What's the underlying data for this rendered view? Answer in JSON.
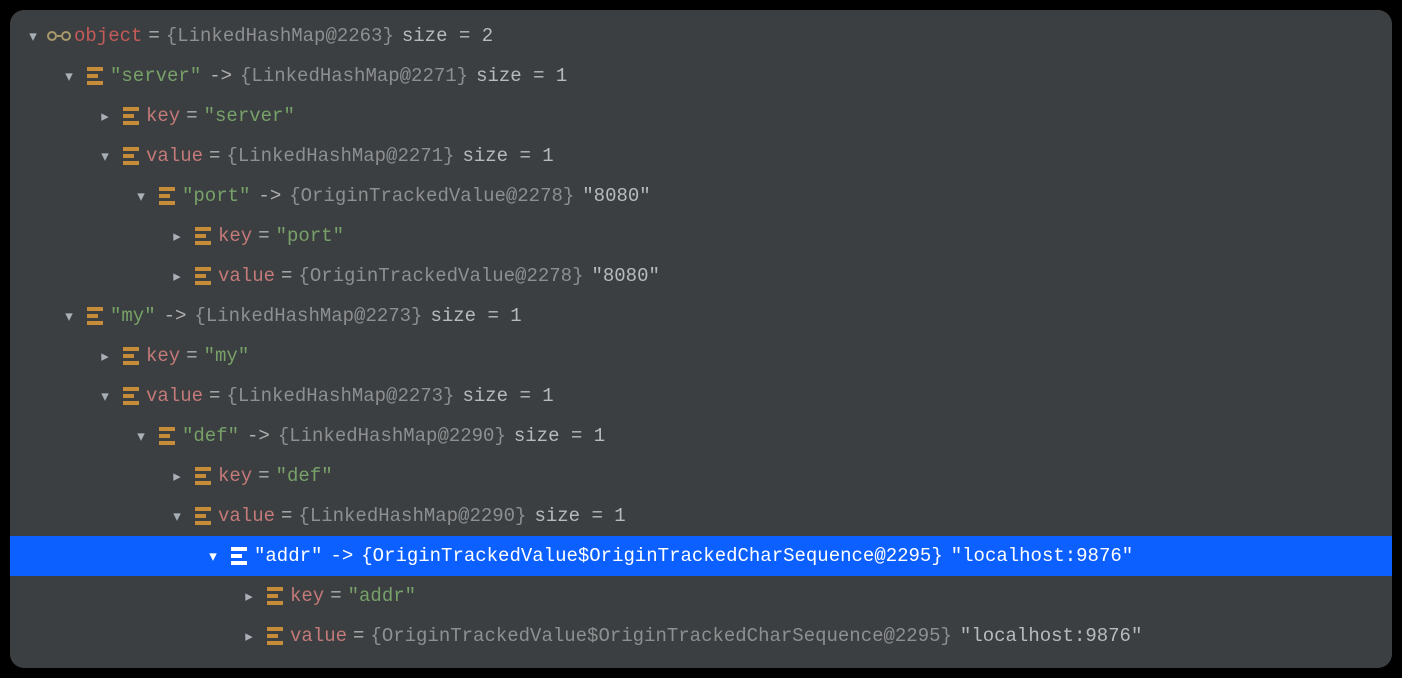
{
  "indentUnit": 36,
  "rows": [
    {
      "indent": 0,
      "expanded": true,
      "icon": "glasses",
      "parts": [
        {
          "cls": "varname",
          "key": "r0.name"
        },
        {
          "cls": "eq",
          "key": "r0.eq"
        },
        {
          "cls": "typeinfo",
          "key": "r0.type"
        },
        {
          "cls": "sizeinfo",
          "key": "r0.size"
        }
      ],
      "data": {
        "name": "object",
        "eq": "=",
        "type": "{LinkedHashMap@2263}",
        "size": " size = 2"
      }
    },
    {
      "indent": 1,
      "expanded": true,
      "icon": "map",
      "parts": [
        {
          "cls": "strval",
          "key": "r1.label"
        },
        {
          "cls": "arrow",
          "key": "r1.arrow"
        },
        {
          "cls": "typeinfo",
          "key": "r1.type"
        },
        {
          "cls": "sizeinfo",
          "key": "r1.size"
        }
      ],
      "data": {
        "label": "\"server\"",
        "arrow": "->",
        "type": "{LinkedHashMap@2271}",
        "size": " size = 1"
      }
    },
    {
      "indent": 2,
      "expanded": false,
      "icon": "map",
      "parts": [
        {
          "cls": "fieldname",
          "key": "r2.name"
        },
        {
          "cls": "eq",
          "key": "r2.eq"
        },
        {
          "cls": "strval",
          "key": "r2.val"
        }
      ],
      "data": {
        "name": "key",
        "eq": "=",
        "val": "\"server\""
      }
    },
    {
      "indent": 2,
      "expanded": true,
      "icon": "map",
      "parts": [
        {
          "cls": "fieldname",
          "key": "r3.name"
        },
        {
          "cls": "eq",
          "key": "r3.eq"
        },
        {
          "cls": "typeinfo",
          "key": "r3.type"
        },
        {
          "cls": "sizeinfo",
          "key": "r3.size"
        }
      ],
      "data": {
        "name": "value",
        "eq": "=",
        "type": "{LinkedHashMap@2271}",
        "size": " size = 1"
      }
    },
    {
      "indent": 3,
      "expanded": true,
      "icon": "map",
      "parts": [
        {
          "cls": "strval",
          "key": "r4.label"
        },
        {
          "cls": "arrow",
          "key": "r4.arrow"
        },
        {
          "cls": "typeinfo",
          "key": "r4.type"
        },
        {
          "cls": "sizeinfo",
          "key": "r4.val"
        }
      ],
      "data": {
        "label": "\"port\"",
        "arrow": "->",
        "type": "{OriginTrackedValue@2278}",
        "val": " \"8080\""
      }
    },
    {
      "indent": 4,
      "expanded": false,
      "icon": "map",
      "parts": [
        {
          "cls": "fieldname",
          "key": "r5.name"
        },
        {
          "cls": "eq",
          "key": "r5.eq"
        },
        {
          "cls": "strval",
          "key": "r5.val"
        }
      ],
      "data": {
        "name": "key",
        "eq": "=",
        "val": "\"port\""
      }
    },
    {
      "indent": 4,
      "expanded": false,
      "icon": "map",
      "parts": [
        {
          "cls": "fieldname",
          "key": "r6.name"
        },
        {
          "cls": "eq",
          "key": "r6.eq"
        },
        {
          "cls": "typeinfo",
          "key": "r6.type"
        },
        {
          "cls": "sizeinfo",
          "key": "r6.val"
        }
      ],
      "data": {
        "name": "value",
        "eq": "=",
        "type": "{OriginTrackedValue@2278}",
        "val": " \"8080\""
      }
    },
    {
      "indent": 1,
      "expanded": true,
      "icon": "map",
      "parts": [
        {
          "cls": "strval",
          "key": "r7.label"
        },
        {
          "cls": "arrow",
          "key": "r7.arrow"
        },
        {
          "cls": "typeinfo",
          "key": "r7.type"
        },
        {
          "cls": "sizeinfo",
          "key": "r7.size"
        }
      ],
      "data": {
        "label": "\"my\"",
        "arrow": "->",
        "type": "{LinkedHashMap@2273}",
        "size": " size = 1"
      }
    },
    {
      "indent": 2,
      "expanded": false,
      "icon": "map",
      "parts": [
        {
          "cls": "fieldname",
          "key": "r8.name"
        },
        {
          "cls": "eq",
          "key": "r8.eq"
        },
        {
          "cls": "strval",
          "key": "r8.val"
        }
      ],
      "data": {
        "name": "key",
        "eq": "=",
        "val": "\"my\""
      }
    },
    {
      "indent": 2,
      "expanded": true,
      "icon": "map",
      "parts": [
        {
          "cls": "fieldname",
          "key": "r9.name"
        },
        {
          "cls": "eq",
          "key": "r9.eq"
        },
        {
          "cls": "typeinfo",
          "key": "r9.type"
        },
        {
          "cls": "sizeinfo",
          "key": "r9.size"
        }
      ],
      "data": {
        "name": "value",
        "eq": "=",
        "type": "{LinkedHashMap@2273}",
        "size": " size = 1"
      }
    },
    {
      "indent": 3,
      "expanded": true,
      "icon": "map",
      "parts": [
        {
          "cls": "strval",
          "key": "r10.label"
        },
        {
          "cls": "arrow",
          "key": "r10.arrow"
        },
        {
          "cls": "typeinfo",
          "key": "r10.type"
        },
        {
          "cls": "sizeinfo",
          "key": "r10.size"
        }
      ],
      "data": {
        "label": "\"def\"",
        "arrow": "->",
        "type": "{LinkedHashMap@2290}",
        "size": " size = 1"
      }
    },
    {
      "indent": 4,
      "expanded": false,
      "icon": "map",
      "parts": [
        {
          "cls": "fieldname",
          "key": "r11.name"
        },
        {
          "cls": "eq",
          "key": "r11.eq"
        },
        {
          "cls": "strval",
          "key": "r11.val"
        }
      ],
      "data": {
        "name": "key",
        "eq": "=",
        "val": "\"def\""
      }
    },
    {
      "indent": 4,
      "expanded": true,
      "icon": "map",
      "parts": [
        {
          "cls": "fieldname",
          "key": "r12.name"
        },
        {
          "cls": "eq",
          "key": "r12.eq"
        },
        {
          "cls": "typeinfo",
          "key": "r12.type"
        },
        {
          "cls": "sizeinfo",
          "key": "r12.size"
        }
      ],
      "data": {
        "name": "value",
        "eq": "=",
        "type": "{LinkedHashMap@2290}",
        "size": " size = 1"
      }
    },
    {
      "indent": 5,
      "expanded": true,
      "icon": "map",
      "selected": true,
      "parts": [
        {
          "cls": "strval",
          "key": "r13.label"
        },
        {
          "cls": "arrow",
          "key": "r13.arrow"
        },
        {
          "cls": "typeinfo",
          "key": "r13.type"
        },
        {
          "cls": "sizeinfo",
          "key": "r13.val"
        }
      ],
      "data": {
        "label": "\"addr\"",
        "arrow": "->",
        "type": "{OriginTrackedValue$OriginTrackedCharSequence@2295}",
        "val": " \"localhost:9876\""
      }
    },
    {
      "indent": 6,
      "expanded": false,
      "icon": "map",
      "parts": [
        {
          "cls": "fieldname",
          "key": "r14.name"
        },
        {
          "cls": "eq",
          "key": "r14.eq"
        },
        {
          "cls": "strval",
          "key": "r14.val"
        }
      ],
      "data": {
        "name": "key",
        "eq": "=",
        "val": "\"addr\""
      }
    },
    {
      "indent": 6,
      "expanded": false,
      "icon": "map",
      "parts": [
        {
          "cls": "fieldname",
          "key": "r15.name"
        },
        {
          "cls": "eq",
          "key": "r15.eq"
        },
        {
          "cls": "typeinfo",
          "key": "r15.type"
        },
        {
          "cls": "sizeinfo",
          "key": "r15.val"
        }
      ],
      "data": {
        "name": "value",
        "eq": "=",
        "type": "{OriginTrackedValue$OriginTrackedCharSequence@2295}",
        "val": " \"localhost:9876\""
      }
    }
  ],
  "r0": {
    "name": "object",
    "eq": "=",
    "type": "{LinkedHashMap@2263}",
    "size": " size = 2"
  },
  "r1": {
    "label": "\"server\"",
    "arrow": "->",
    "type": "{LinkedHashMap@2271}",
    "size": " size = 1"
  },
  "r2": {
    "name": "key",
    "eq": "=",
    "val": "\"server\""
  },
  "r3": {
    "name": "value",
    "eq": "=",
    "type": "{LinkedHashMap@2271}",
    "size": " size = 1"
  },
  "r4": {
    "label": "\"port\"",
    "arrow": "->",
    "type": "{OriginTrackedValue@2278}",
    "val": " \"8080\""
  },
  "r5": {
    "name": "key",
    "eq": "=",
    "val": "\"port\""
  },
  "r6": {
    "name": "value",
    "eq": "=",
    "type": "{OriginTrackedValue@2278}",
    "val": " \"8080\""
  },
  "r7": {
    "label": "\"my\"",
    "arrow": "->",
    "type": "{LinkedHashMap@2273}",
    "size": " size = 1"
  },
  "r8": {
    "name": "key",
    "eq": "=",
    "val": "\"my\""
  },
  "r9": {
    "name": "value",
    "eq": "=",
    "type": "{LinkedHashMap@2273}",
    "size": " size = 1"
  },
  "r10": {
    "label": "\"def\"",
    "arrow": "->",
    "type": "{LinkedHashMap@2290}",
    "size": " size = 1"
  },
  "r11": {
    "name": "key",
    "eq": "=",
    "val": "\"def\""
  },
  "r12": {
    "name": "value",
    "eq": "=",
    "type": "{LinkedHashMap@2290}",
    "size": " size = 1"
  },
  "r13": {
    "label": "\"addr\"",
    "arrow": "->",
    "type": "{OriginTrackedValue$OriginTrackedCharSequence@2295}",
    "val": " \"localhost:9876\""
  },
  "r14": {
    "name": "key",
    "eq": "=",
    "val": "\"addr\""
  },
  "r15": {
    "name": "value",
    "eq": "=",
    "type": "{OriginTrackedValue$OriginTrackedCharSequence@2295}",
    "val": " \"localhost:9876\""
  }
}
